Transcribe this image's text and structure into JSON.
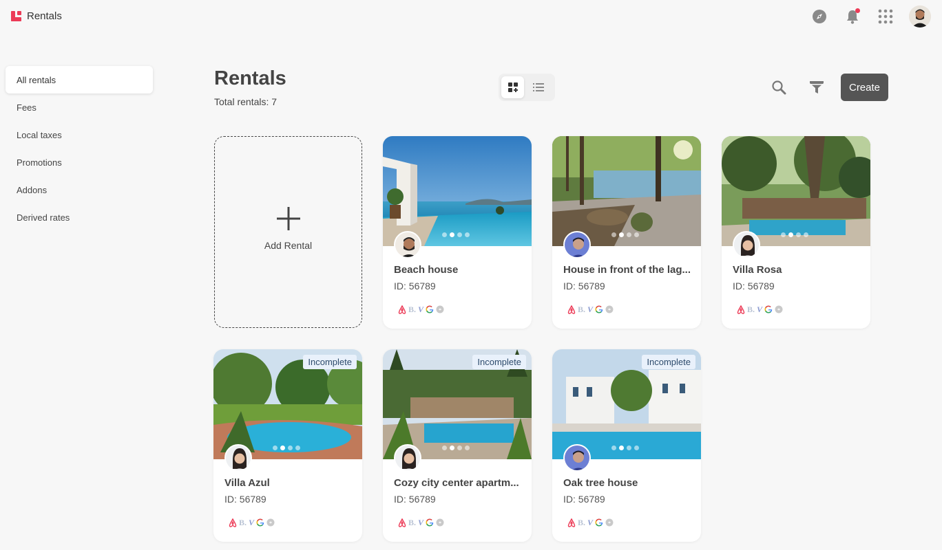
{
  "app": {
    "name": "Rentals"
  },
  "topbar": {
    "icons": [
      "compass-icon",
      "bell-icon",
      "apps-grid-icon",
      "user-avatar"
    ],
    "notification_dot_color": "#ec3b57"
  },
  "sidebar": {
    "items": [
      {
        "label": "All rentals",
        "active": true
      },
      {
        "label": "Fees"
      },
      {
        "label": "Local taxes"
      },
      {
        "label": "Promotions"
      },
      {
        "label": "Addons"
      },
      {
        "label": "Derived rates"
      }
    ]
  },
  "header": {
    "title": "Rentals",
    "subtitle": "Total rentals: 7",
    "view_mode": "grid",
    "create_label": "Create"
  },
  "add_card": {
    "label": "Add Rental"
  },
  "rentals": [
    {
      "name": "Beach house",
      "id": "ID: 56789",
      "badge": "",
      "photo_index": 2,
      "photo_count": 4,
      "scene": "beach"
    },
    {
      "name": "House in front of the lag...",
      "id": "ID: 56789",
      "badge": "",
      "photo_index": 2,
      "photo_count": 4,
      "scene": "lagoon"
    },
    {
      "name": "Villa Rosa",
      "id": "ID: 56789",
      "badge": "",
      "photo_index": 2,
      "photo_count": 4,
      "scene": "rosa"
    },
    {
      "name": "Villa Azul",
      "id": "ID: 56789",
      "badge": "Incomplete",
      "photo_index": 2,
      "photo_count": 4,
      "scene": "azul"
    },
    {
      "name": "Cozy city center apartm...",
      "id": "ID: 56789",
      "badge": "Incomplete",
      "photo_index": 2,
      "photo_count": 4,
      "scene": "cozy"
    },
    {
      "name": "Oak tree house",
      "id": "ID: 56789",
      "badge": "Incomplete",
      "photo_index": 2,
      "photo_count": 4,
      "scene": "oak"
    }
  ],
  "channels": {
    "booking_letter": "B.",
    "vrbo_letter": "V",
    "icons": [
      "airbnb-icon",
      "booking-icon",
      "vrbo-icon",
      "google-icon",
      "other-channel-icon"
    ]
  },
  "colors": {
    "brand": "#ec3b57",
    "create_button": "#555555",
    "badge_bg": "#e9f1fb",
    "badge_text": "#2c4a6b"
  }
}
